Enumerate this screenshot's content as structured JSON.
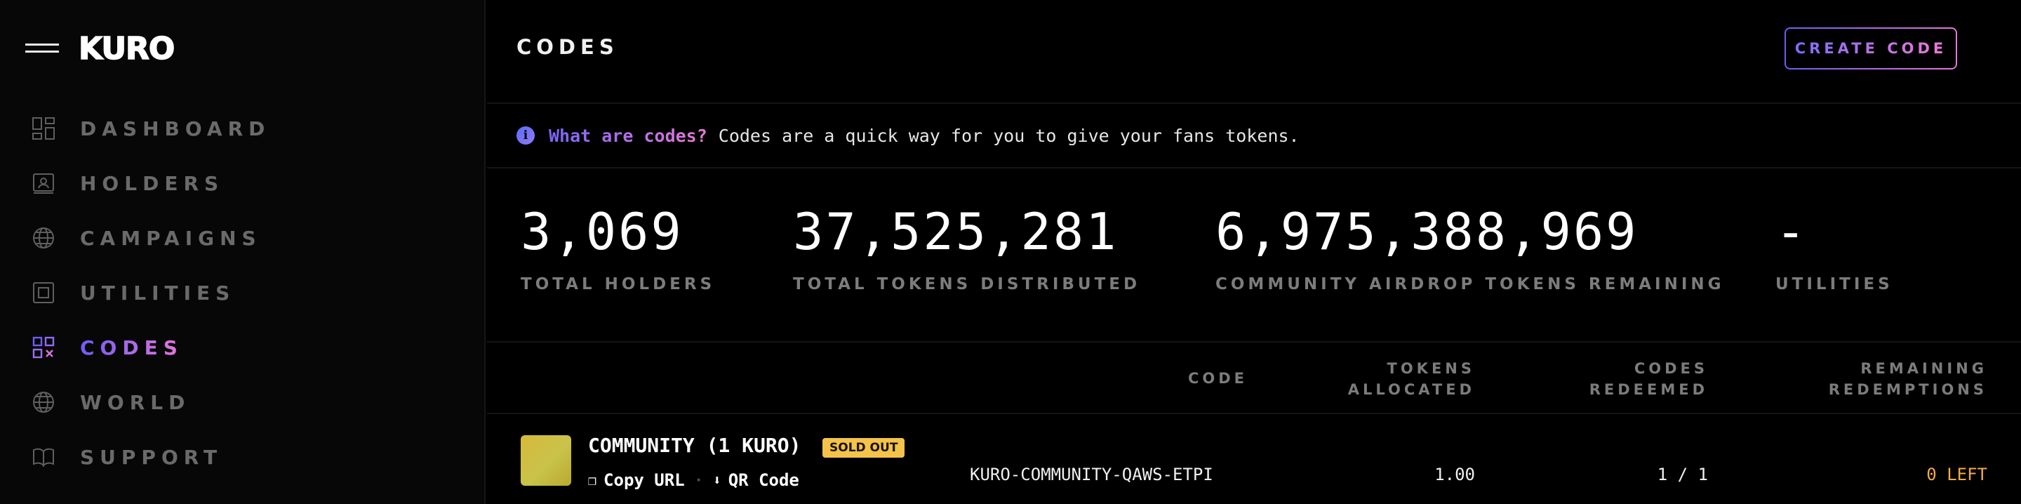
{
  "app": {
    "logo": "KURO"
  },
  "sidebar": {
    "items": [
      {
        "label": "DASHBOARD",
        "icon": "dashboard-icon"
      },
      {
        "label": "HOLDERS",
        "icon": "holders-icon"
      },
      {
        "label": "CAMPAIGNS",
        "icon": "globe-icon"
      },
      {
        "label": "UTILITIES",
        "icon": "utilities-icon"
      },
      {
        "label": "CODES",
        "icon": "qr-code-icon",
        "active": true
      },
      {
        "label": "WORLD",
        "icon": "globe-icon"
      },
      {
        "label": "SUPPORT",
        "icon": "book-icon"
      }
    ]
  },
  "header": {
    "title": "CODES",
    "create_label": "CREATE CODE"
  },
  "info": {
    "question": "What are codes?",
    "text": "Codes are a quick way for you to give your fans tokens."
  },
  "stats": [
    {
      "value": "3,069",
      "label": "TOTAL HOLDERS"
    },
    {
      "value": "37,525,281",
      "label": "TOTAL TOKENS DISTRIBUTED"
    },
    {
      "value": "6,975,388,969",
      "label": "COMMUNITY AIRDROP TOKENS REMAINING"
    },
    {
      "value": "-",
      "label": "UTILITIES"
    }
  ],
  "table": {
    "headers": {
      "code": "CODE",
      "tokens_1": "TOKENS",
      "tokens_2": "ALLOCATED",
      "redeemed_1": "CODES",
      "redeemed_2": "REDEEMED",
      "remaining_1": "REMAINING",
      "remaining_2": "REDEMPTIONS"
    },
    "rows": [
      {
        "name": "COMMUNITY (1 KURO)",
        "badge": "SOLD OUT",
        "copy_label": "Copy URL",
        "qr_label": "QR Code",
        "code": "KURO-COMMUNITY-QAWS-ETPI",
        "tokens": "1.00",
        "redeemed": "1 / 1",
        "remaining": "0 LEFT"
      }
    ]
  },
  "colors": {
    "accent_start": "#6f5cf6",
    "accent_end": "#e776d8",
    "badge": "#f3c34a",
    "remaining": "#f3a94b"
  }
}
